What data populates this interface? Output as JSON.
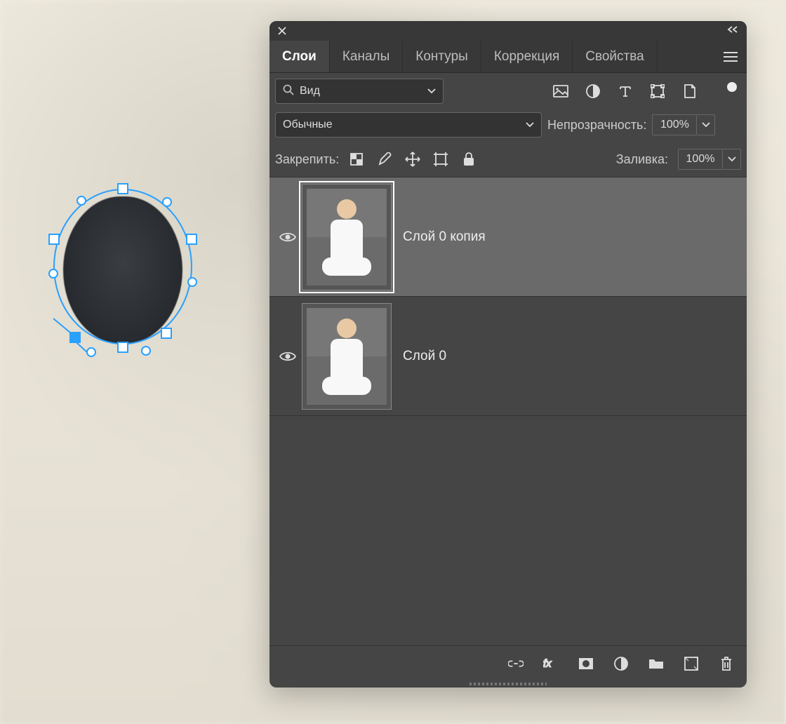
{
  "tabs": [
    "Слои",
    "Каналы",
    "Контуры",
    "Коррекция",
    "Свойства"
  ],
  "active_tab": 0,
  "filter": {
    "dropdown_label": "Вид"
  },
  "blend": {
    "mode": "Обычные",
    "opacity_label": "Непрозрачность:",
    "opacity_value": "100%"
  },
  "lock": {
    "label": "Закрепить:",
    "fill_label": "Заливка:",
    "fill_value": "100%"
  },
  "layers": [
    {
      "name": "Слой 0 копия",
      "visible": true,
      "selected": true
    },
    {
      "name": "Слой 0",
      "visible": true,
      "selected": false
    }
  ]
}
